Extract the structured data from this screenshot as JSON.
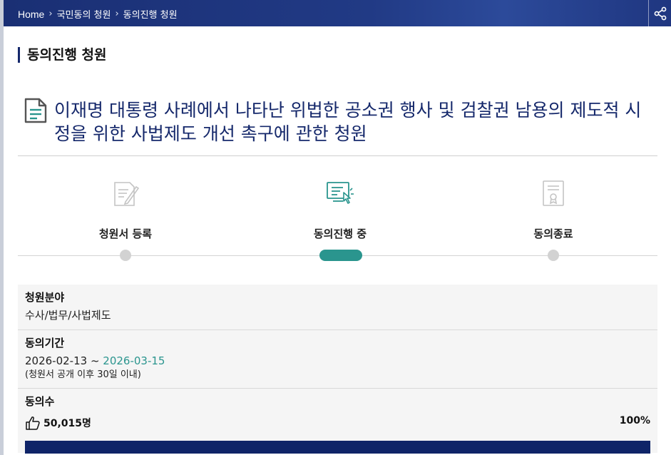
{
  "breadcrumb": {
    "items": [
      "Home",
      "국민동의 청원",
      "동의진행 청원"
    ],
    "separator": "›"
  },
  "section_title": "동의진행 청원",
  "petition": {
    "title": "이재명 대통령 사례에서 나타난 위법한 공소권 행사 및 검찰권 남용의 제도적 시정을 위한 사법제도 개선 촉구에 관한 청원"
  },
  "steps": [
    {
      "label": "청원서 등록",
      "icon": "document-pen-icon",
      "active": false
    },
    {
      "label": "동의진행 중",
      "icon": "monitor-click-icon",
      "active": true
    },
    {
      "label": "동의종료",
      "icon": "certificate-icon",
      "active": false
    }
  ],
  "info": {
    "field_label": "청원분야",
    "field_value": "수사/법무/사법제도",
    "period_label": "동의기간",
    "period_start": "2026-02-13",
    "period_sep": " ~ ",
    "period_end": "2026-03-15",
    "period_note": "(청원서 공개 이후 30일 이내)",
    "count_label": "동의수",
    "count_value": "50,015명",
    "percent_text": "100%",
    "progress_fraction": 1.0
  },
  "colors": {
    "navy": "#15286b",
    "teal": "#2a958e",
    "bar": "#0f2468"
  }
}
